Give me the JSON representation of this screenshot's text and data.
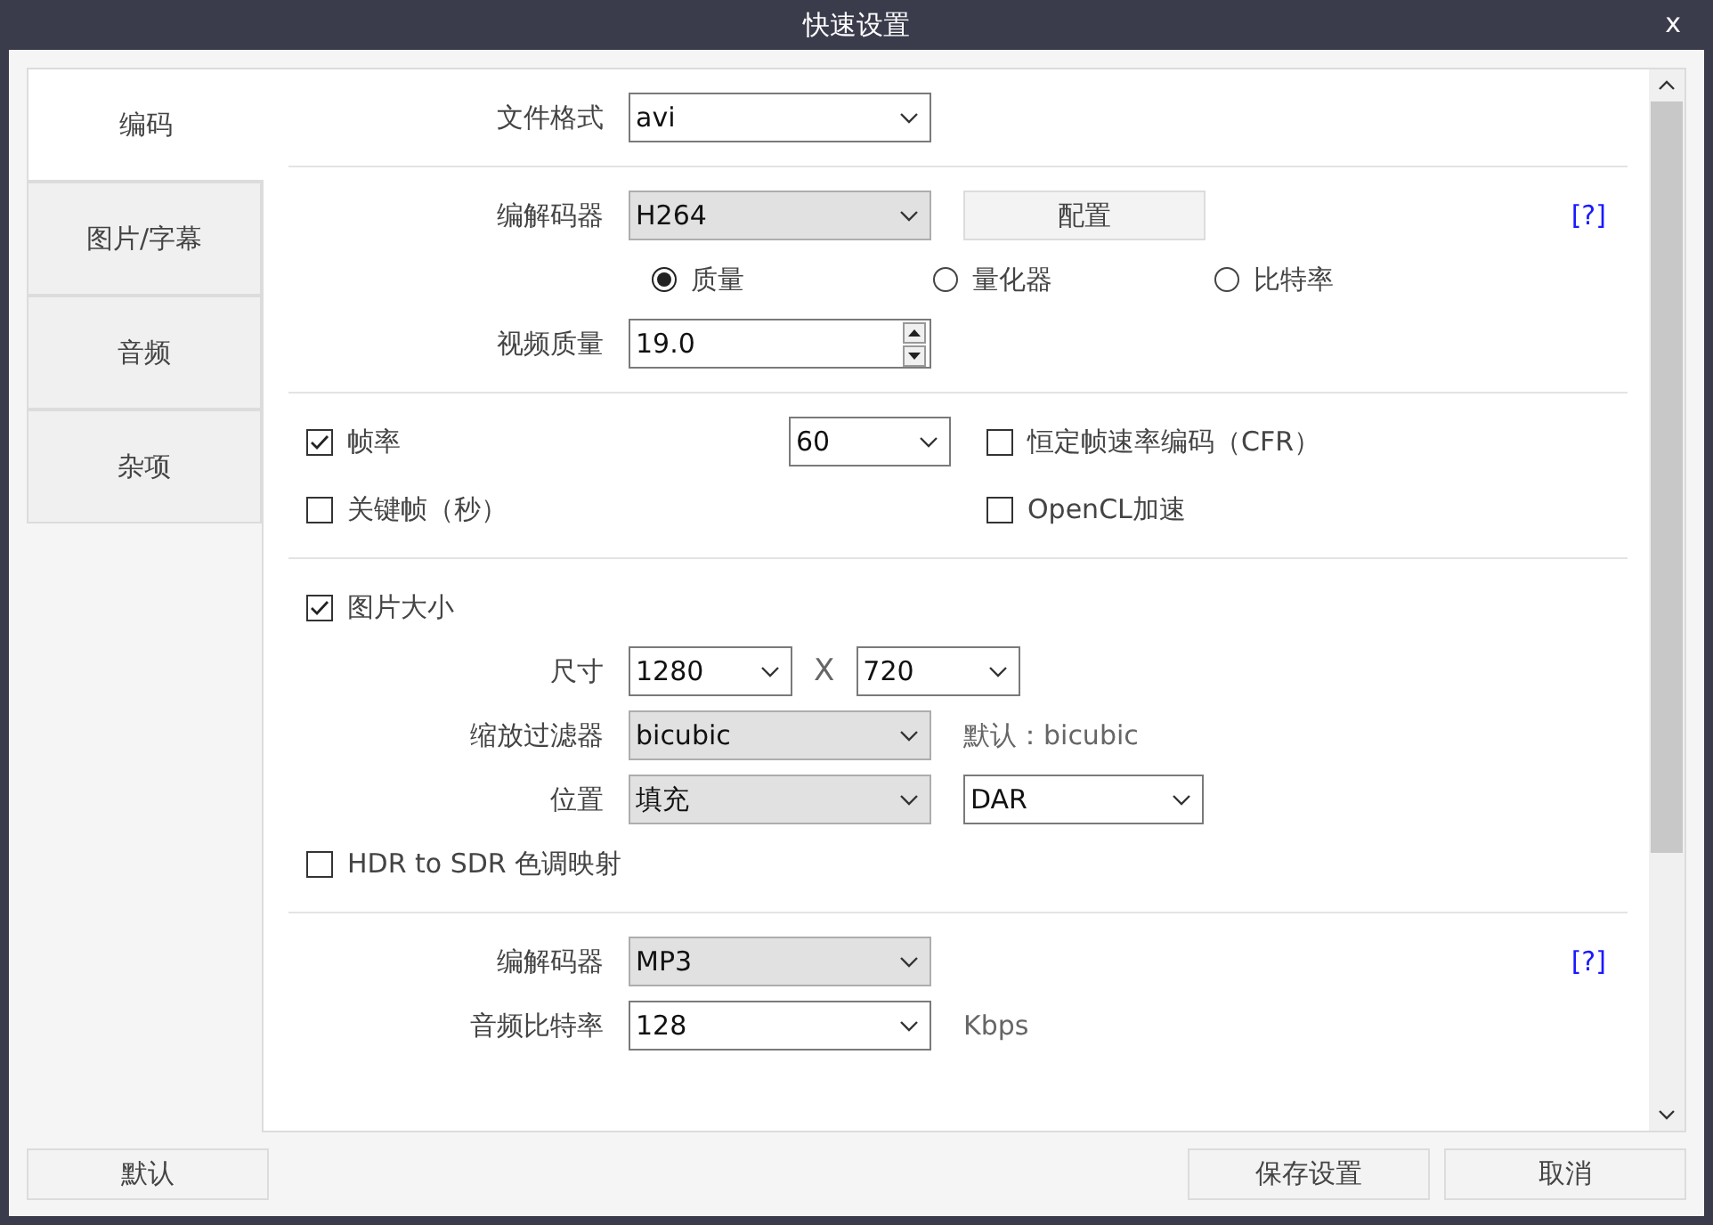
{
  "window": {
    "title": "快速设置",
    "close": "x"
  },
  "tabs": [
    {
      "label": "编码",
      "selected": true
    },
    {
      "label": "图片/字幕",
      "selected": false
    },
    {
      "label": "音频",
      "selected": false
    },
    {
      "label": "杂项",
      "selected": false
    }
  ],
  "sections": [
    {
      "rows": [
        {
          "kind": "field",
          "label": "文件格式",
          "controls": [
            {
              "kind": "select",
              "value": "avi",
              "editable": true
            }
          ]
        }
      ]
    },
    {
      "rows": [
        {
          "kind": "field",
          "label": "编解码器",
          "help": "[?]",
          "controls": [
            {
              "kind": "select",
              "value": "H264",
              "editable": false
            },
            {
              "kind": "button",
              "label": "配置"
            }
          ]
        },
        {
          "kind": "radios",
          "options": [
            {
              "label": "质量",
              "selected": true
            },
            {
              "label": "量化器",
              "selected": false
            },
            {
              "label": "比特率",
              "selected": false
            }
          ]
        },
        {
          "kind": "field",
          "label": "视频质量",
          "controls": [
            {
              "kind": "spin",
              "value": "19.0"
            }
          ]
        }
      ]
    },
    {
      "rows": [
        {
          "kind": "checkgrid",
          "items": [
            {
              "label": "帧率",
              "checked": true,
              "select": "60"
            },
            {
              "label": "恒定帧速率编码（CFR）",
              "checked": false
            },
            {
              "label": "关键帧（秒）",
              "checked": false
            },
            {
              "label": "OpenCL加速",
              "checked": false
            }
          ]
        }
      ]
    },
    {
      "rows": [
        {
          "kind": "check",
          "label": "图片大小",
          "checked": true
        },
        {
          "kind": "field",
          "label": "尺寸",
          "controls": [
            {
              "kind": "select",
              "value": "1280",
              "editable": true
            },
            {
              "kind": "times",
              "text": "X"
            },
            {
              "kind": "select",
              "value": "720",
              "editable": true
            }
          ]
        },
        {
          "kind": "field",
          "label": "缩放过滤器",
          "controls": [
            {
              "kind": "select",
              "value": "bicubic",
              "editable": false
            },
            {
              "kind": "note",
              "text": "默认：bicubic"
            }
          ]
        },
        {
          "kind": "field",
          "label": "位置",
          "controls": [
            {
              "kind": "select",
              "value": "填充",
              "editable": false
            },
            {
              "kind": "select",
              "value": "DAR",
              "editable": true
            }
          ]
        },
        {
          "kind": "check",
          "label": "HDR to SDR 色调映射",
          "checked": false
        }
      ]
    },
    {
      "rows": [
        {
          "kind": "field",
          "label": "编解码器",
          "help": "[?]",
          "controls": [
            {
              "kind": "select",
              "value": "MP3",
              "editable": false
            }
          ]
        },
        {
          "kind": "field",
          "label": "音频比特率",
          "controls": [
            {
              "kind": "select",
              "value": "128",
              "editable": true
            },
            {
              "kind": "note",
              "text": "Kbps"
            }
          ]
        }
      ]
    }
  ],
  "buttons": {
    "left": [
      "默认"
    ],
    "right": [
      "保存设置",
      "取消"
    ]
  }
}
